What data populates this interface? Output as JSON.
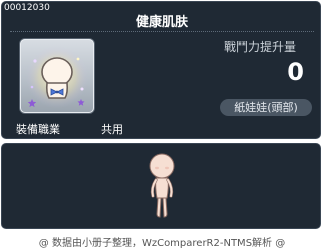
{
  "tooltip": {
    "item_id": "00012030",
    "item_name": "健康肌肤",
    "power_label": "戰鬥力提升量",
    "power_value": "0",
    "job_label": "裝備職業",
    "job_value": "共用",
    "category": "紙娃娃(頭部)",
    "icon": "mannequin-head-icon"
  },
  "preview": {
    "figure": "mannequin-body-figure"
  },
  "footer": {
    "credit": "@ 数据由小册子整理，WzComparerR2-NTMS解析 @"
  }
}
